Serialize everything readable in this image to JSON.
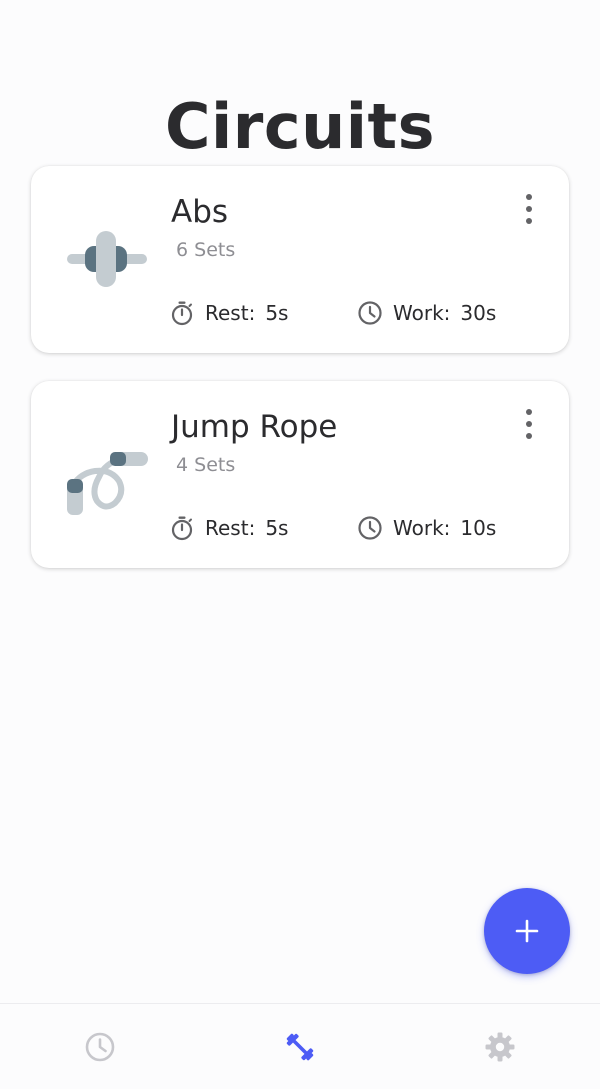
{
  "page": {
    "title": "Circuits"
  },
  "circuits": [
    {
      "title": "Abs",
      "sets": "6 Sets",
      "rest_label": "Rest:",
      "rest_value": "5s",
      "work_label": "Work:",
      "work_value": "30s",
      "icon": "ab-roller-icon"
    },
    {
      "title": "Jump Rope",
      "sets": "4 Sets",
      "rest_label": "Rest:",
      "rest_value": "5s",
      "work_label": "Work:",
      "work_value": "10s",
      "icon": "jump-rope-icon"
    }
  ],
  "fab": {
    "icon": "plus-icon"
  },
  "bottom_nav": {
    "items": [
      {
        "icon": "clock-icon",
        "active": false
      },
      {
        "icon": "dumbbell-icon",
        "active": true
      },
      {
        "icon": "gear-icon",
        "active": false
      }
    ]
  },
  "colors": {
    "accent": "#4d5cf5",
    "text": "#2b2b2e",
    "muted": "#8e8e93",
    "inactive_icon": "#c7c7cc"
  }
}
